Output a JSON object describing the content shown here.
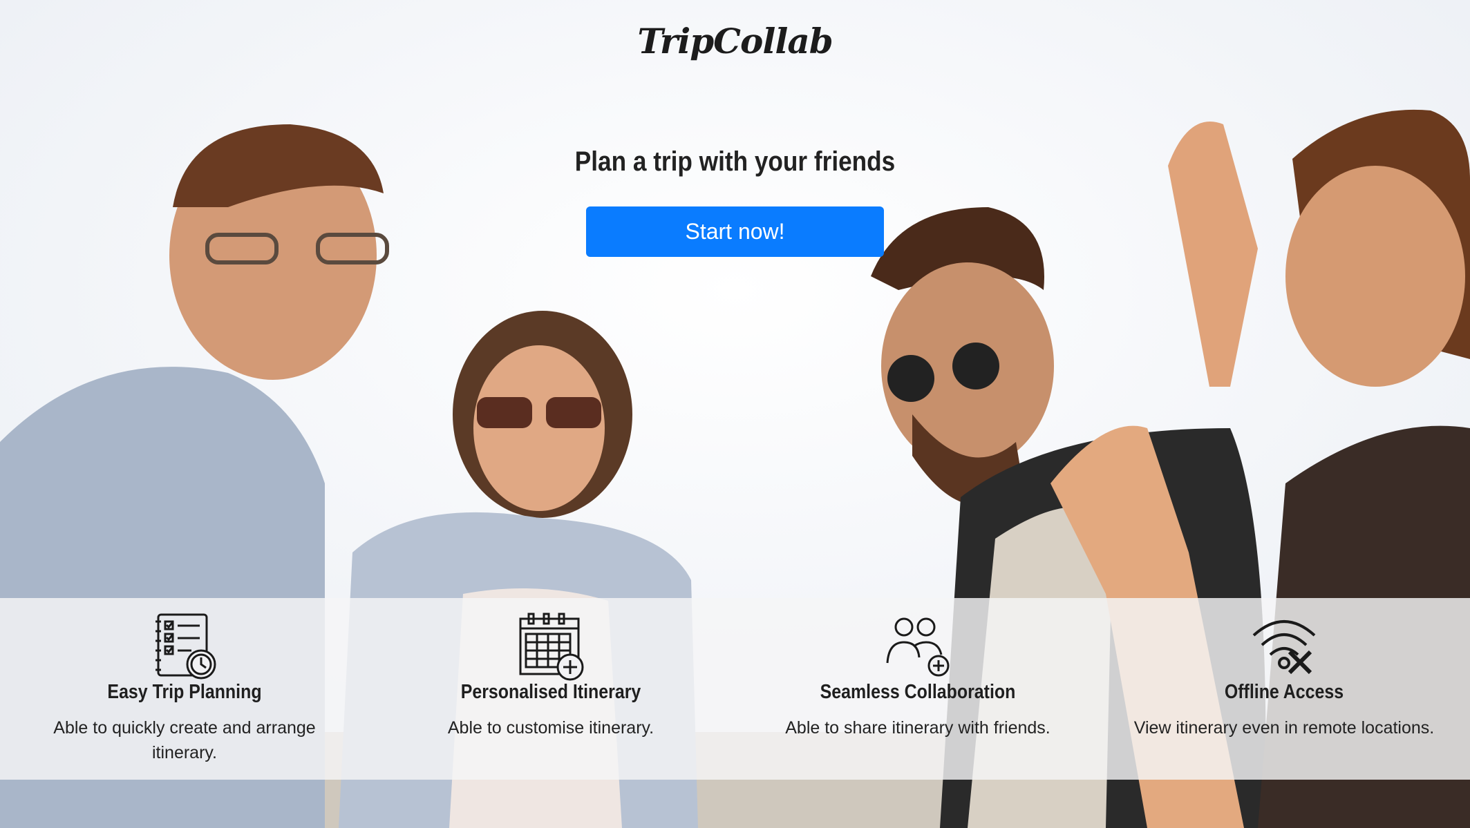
{
  "brand": {
    "logo_text": "TripCollab"
  },
  "hero": {
    "headline": "Plan a trip with your friends",
    "cta_label": "Start now!",
    "accent_color": "#0a7cff"
  },
  "features": [
    {
      "icon": "checklist-clock-icon",
      "title": "Easy Trip Planning",
      "desc": "Able to quickly create and arrange itinerary."
    },
    {
      "icon": "calendar-add-icon",
      "title": "Personalised Itinerary",
      "desc": "Able to customise itinerary."
    },
    {
      "icon": "users-add-icon",
      "title": "Seamless Collaboration",
      "desc": "Able to share itinerary with friends."
    },
    {
      "icon": "wifi-off-icon",
      "title": "Offline Access",
      "desc": "View itinerary even in remote locations."
    }
  ]
}
